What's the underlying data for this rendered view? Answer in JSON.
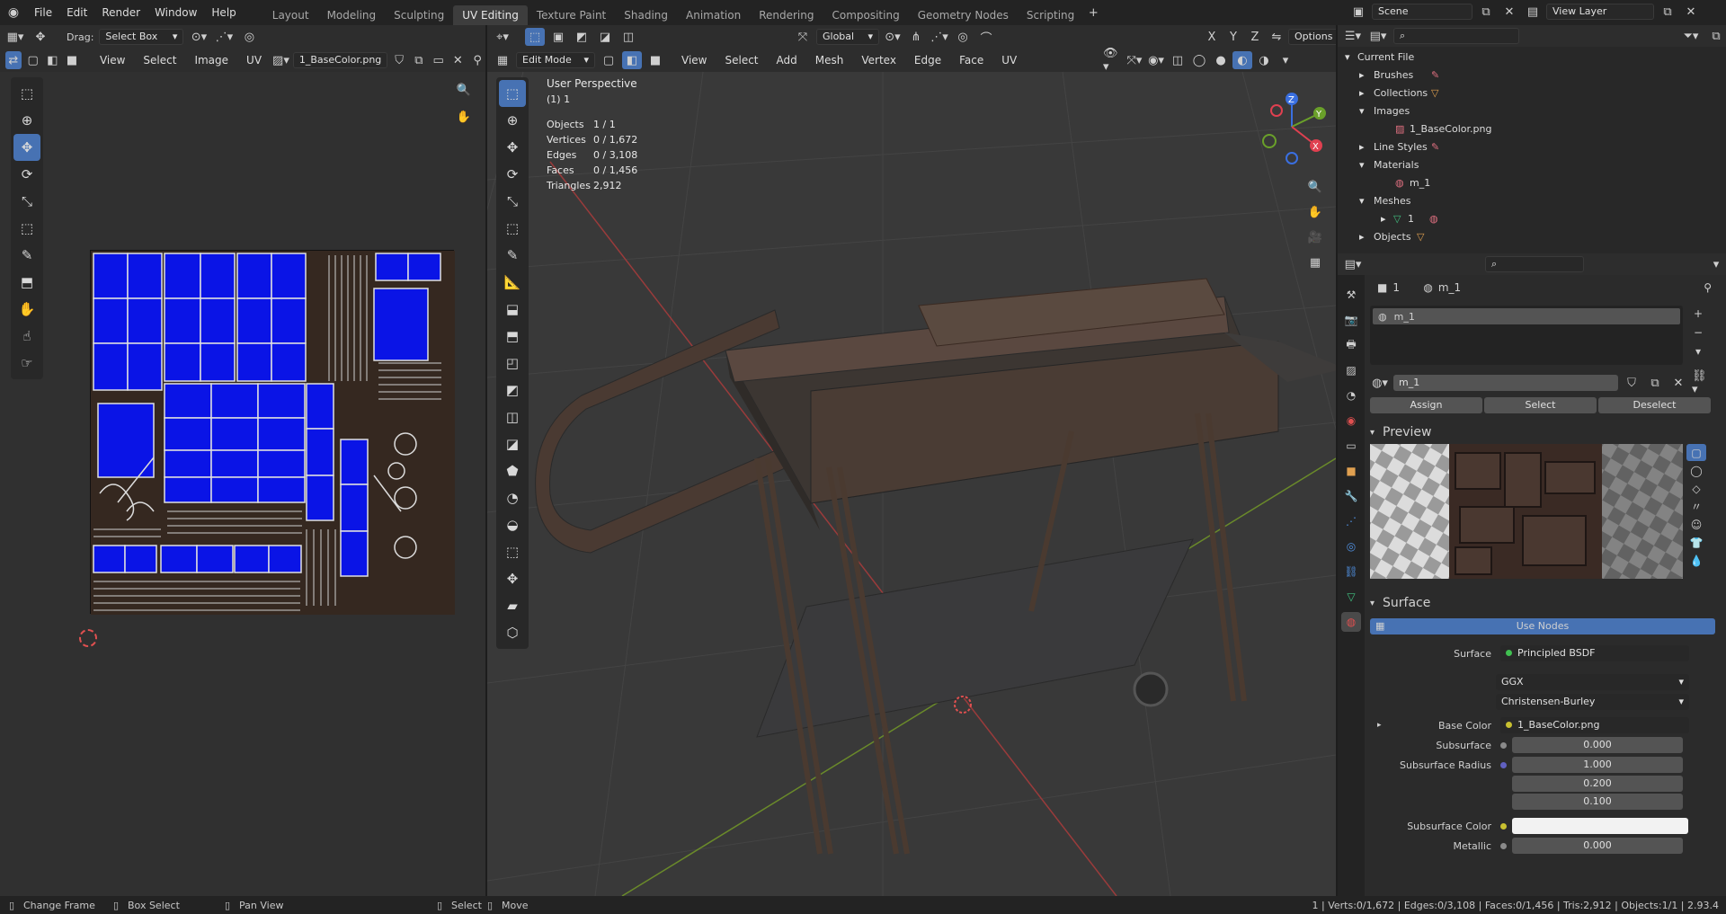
{
  "topbar": {
    "menus": [
      "File",
      "Edit",
      "Render",
      "Window",
      "Help"
    ],
    "workspaces": [
      "Layout",
      "Modeling",
      "Sculpting",
      "UV Editing",
      "Texture Paint",
      "Shading",
      "Animation",
      "Rendering",
      "Compositing",
      "Geometry Nodes",
      "Scripting"
    ],
    "scene": "Scene",
    "view_layer": "View Layer"
  },
  "uv": {
    "drag_label": "Drag:",
    "drag_value": "Select Box",
    "menus": [
      "View",
      "Select",
      "Image",
      "UV"
    ],
    "image_name": "1_BaseColor.png"
  },
  "viewport": {
    "mode": "Edit Mode",
    "menus": [
      "View",
      "Select",
      "Add",
      "Mesh",
      "Vertex",
      "Edge",
      "Face",
      "UV"
    ],
    "transform": "Global",
    "options": "Options",
    "title": "User Perspective",
    "subtitle": "(1) 1",
    "stats": [
      {
        "label": "Objects",
        "value": "1 / 1"
      },
      {
        "label": "Vertices",
        "value": "0 / 1,672"
      },
      {
        "label": "Edges",
        "value": "0 / 3,108"
      },
      {
        "label": "Faces",
        "value": "0 / 1,456"
      },
      {
        "label": "Triangles",
        "value": "2,912"
      }
    ]
  },
  "outliner": {
    "root": "Current File",
    "items": [
      {
        "label": "Brushes"
      },
      {
        "label": "Collections"
      },
      {
        "label": "Images"
      },
      {
        "label": "1_BaseColor.png"
      },
      {
        "label": "Line Styles"
      },
      {
        "label": "Materials"
      },
      {
        "label": "m_1"
      },
      {
        "label": "Meshes"
      },
      {
        "label": "1"
      },
      {
        "label": "Objects"
      }
    ]
  },
  "properties": {
    "object": "1",
    "material": "m_1",
    "slot": "m_1",
    "mat_name": "m_1",
    "assign": "Assign",
    "select": "Select",
    "deselect": "Deselect",
    "preview": "Preview",
    "surface_panel": "Surface",
    "use_nodes": "Use Nodes",
    "rows": [
      {
        "label": "Surface",
        "value": "Principled BSDF"
      },
      {
        "label": "",
        "value": "GGX"
      },
      {
        "label": "",
        "value": "Christensen-Burley"
      },
      {
        "label": "Base Color",
        "value": "1_BaseColor.png"
      },
      {
        "label": "Subsurface",
        "value": "0.000"
      },
      {
        "label": "Subsurface Radius",
        "value": "1.000"
      },
      {
        "label": "",
        "value": "0.200"
      },
      {
        "label": "",
        "value": "0.100"
      },
      {
        "label": "Subsurface Color",
        "value": ""
      },
      {
        "label": "Metallic",
        "value": "0.000"
      }
    ]
  },
  "statusbar": {
    "items": [
      "Change Frame",
      "Box Select",
      "Pan View",
      "Select",
      "Move"
    ],
    "stats": "1 | Verts:0/1,672 | Edges:0/3,108 | Faces:0/1,456 | Tris:2,912 | Objects:1/1 | 2.93.4"
  },
  "colors": {
    "accent": "#4772b3",
    "uv_island": "#0a14e6",
    "bg": "#303030"
  }
}
